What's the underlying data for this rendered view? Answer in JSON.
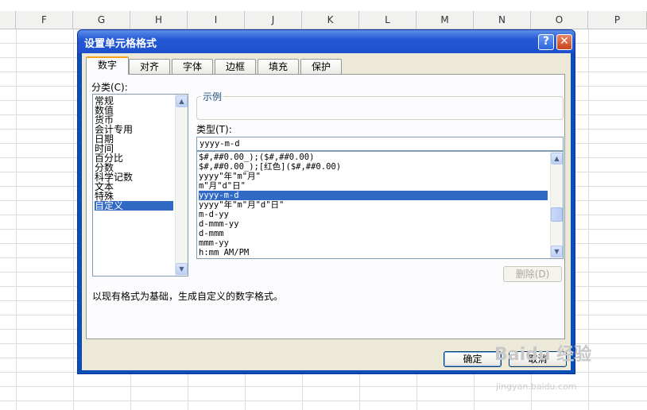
{
  "spreadsheet": {
    "columns": [
      "F",
      "G",
      "H",
      "I",
      "J",
      "K",
      "L",
      "M",
      "N",
      "O",
      "P"
    ]
  },
  "dialog": {
    "title": "设置单元格格式",
    "help_label": "?",
    "close_label": "✕",
    "tabs": [
      {
        "label": "数字",
        "active": true
      },
      {
        "label": "对齐",
        "active": false
      },
      {
        "label": "字体",
        "active": false
      },
      {
        "label": "边框",
        "active": false
      },
      {
        "label": "填充",
        "active": false
      },
      {
        "label": "保护",
        "active": false
      }
    ],
    "category_label": "分类(C):",
    "categories": [
      "常规",
      "数值",
      "货币",
      "会计专用",
      "日期",
      "时间",
      "百分比",
      "分数",
      "科学记数",
      "文本",
      "特殊",
      "自定义"
    ],
    "selected_category": "自定义",
    "sample_label": "示例",
    "type_label": "类型(T):",
    "type_value": "yyyy-m-d",
    "formats": [
      "$#,##0.00_);($#,##0.00)",
      "$#,##0.00_);[红色]($#,##0.00)",
      "yyyy\"年\"m\"月\"",
      "m\"月\"d\"日\"",
      "yyyy-m-d",
      "yyyy\"年\"m\"月\"d\"日\"",
      "m-d-yy",
      "d-mmm-yy",
      "d-mmm",
      "mmm-yy",
      "h:mm AM/PM"
    ],
    "selected_format": "yyyy-m-d",
    "delete_label": "删除(D)",
    "description": "以现有格式为基础，生成自定义的数字格式。",
    "ok_label": "确定",
    "cancel_label": "取消"
  },
  "watermark": {
    "text": "Baidu 经验",
    "subtext": "jingyan.baidu.com"
  }
}
